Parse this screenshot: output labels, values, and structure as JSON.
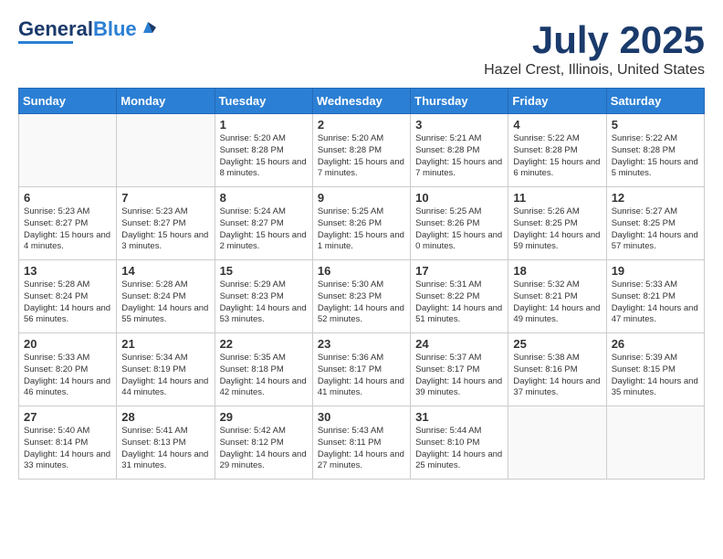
{
  "header": {
    "logo_general": "General",
    "logo_blue": "Blue",
    "month": "July 2025",
    "location": "Hazel Crest, Illinois, United States"
  },
  "weekdays": [
    "Sunday",
    "Monday",
    "Tuesday",
    "Wednesday",
    "Thursday",
    "Friday",
    "Saturday"
  ],
  "weeks": [
    [
      {
        "day": "",
        "info": ""
      },
      {
        "day": "",
        "info": ""
      },
      {
        "day": "1",
        "info": "Sunrise: 5:20 AM\nSunset: 8:28 PM\nDaylight: 15 hours and 8 minutes."
      },
      {
        "day": "2",
        "info": "Sunrise: 5:20 AM\nSunset: 8:28 PM\nDaylight: 15 hours and 7 minutes."
      },
      {
        "day": "3",
        "info": "Sunrise: 5:21 AM\nSunset: 8:28 PM\nDaylight: 15 hours and 7 minutes."
      },
      {
        "day": "4",
        "info": "Sunrise: 5:22 AM\nSunset: 8:28 PM\nDaylight: 15 hours and 6 minutes."
      },
      {
        "day": "5",
        "info": "Sunrise: 5:22 AM\nSunset: 8:28 PM\nDaylight: 15 hours and 5 minutes."
      }
    ],
    [
      {
        "day": "6",
        "info": "Sunrise: 5:23 AM\nSunset: 8:27 PM\nDaylight: 15 hours and 4 minutes."
      },
      {
        "day": "7",
        "info": "Sunrise: 5:23 AM\nSunset: 8:27 PM\nDaylight: 15 hours and 3 minutes."
      },
      {
        "day": "8",
        "info": "Sunrise: 5:24 AM\nSunset: 8:27 PM\nDaylight: 15 hours and 2 minutes."
      },
      {
        "day": "9",
        "info": "Sunrise: 5:25 AM\nSunset: 8:26 PM\nDaylight: 15 hours and 1 minute."
      },
      {
        "day": "10",
        "info": "Sunrise: 5:25 AM\nSunset: 8:26 PM\nDaylight: 15 hours and 0 minutes."
      },
      {
        "day": "11",
        "info": "Sunrise: 5:26 AM\nSunset: 8:25 PM\nDaylight: 14 hours and 59 minutes."
      },
      {
        "day": "12",
        "info": "Sunrise: 5:27 AM\nSunset: 8:25 PM\nDaylight: 14 hours and 57 minutes."
      }
    ],
    [
      {
        "day": "13",
        "info": "Sunrise: 5:28 AM\nSunset: 8:24 PM\nDaylight: 14 hours and 56 minutes."
      },
      {
        "day": "14",
        "info": "Sunrise: 5:28 AM\nSunset: 8:24 PM\nDaylight: 14 hours and 55 minutes."
      },
      {
        "day": "15",
        "info": "Sunrise: 5:29 AM\nSunset: 8:23 PM\nDaylight: 14 hours and 53 minutes."
      },
      {
        "day": "16",
        "info": "Sunrise: 5:30 AM\nSunset: 8:23 PM\nDaylight: 14 hours and 52 minutes."
      },
      {
        "day": "17",
        "info": "Sunrise: 5:31 AM\nSunset: 8:22 PM\nDaylight: 14 hours and 51 minutes."
      },
      {
        "day": "18",
        "info": "Sunrise: 5:32 AM\nSunset: 8:21 PM\nDaylight: 14 hours and 49 minutes."
      },
      {
        "day": "19",
        "info": "Sunrise: 5:33 AM\nSunset: 8:21 PM\nDaylight: 14 hours and 47 minutes."
      }
    ],
    [
      {
        "day": "20",
        "info": "Sunrise: 5:33 AM\nSunset: 8:20 PM\nDaylight: 14 hours and 46 minutes."
      },
      {
        "day": "21",
        "info": "Sunrise: 5:34 AM\nSunset: 8:19 PM\nDaylight: 14 hours and 44 minutes."
      },
      {
        "day": "22",
        "info": "Sunrise: 5:35 AM\nSunset: 8:18 PM\nDaylight: 14 hours and 42 minutes."
      },
      {
        "day": "23",
        "info": "Sunrise: 5:36 AM\nSunset: 8:17 PM\nDaylight: 14 hours and 41 minutes."
      },
      {
        "day": "24",
        "info": "Sunrise: 5:37 AM\nSunset: 8:17 PM\nDaylight: 14 hours and 39 minutes."
      },
      {
        "day": "25",
        "info": "Sunrise: 5:38 AM\nSunset: 8:16 PM\nDaylight: 14 hours and 37 minutes."
      },
      {
        "day": "26",
        "info": "Sunrise: 5:39 AM\nSunset: 8:15 PM\nDaylight: 14 hours and 35 minutes."
      }
    ],
    [
      {
        "day": "27",
        "info": "Sunrise: 5:40 AM\nSunset: 8:14 PM\nDaylight: 14 hours and 33 minutes."
      },
      {
        "day": "28",
        "info": "Sunrise: 5:41 AM\nSunset: 8:13 PM\nDaylight: 14 hours and 31 minutes."
      },
      {
        "day": "29",
        "info": "Sunrise: 5:42 AM\nSunset: 8:12 PM\nDaylight: 14 hours and 29 minutes."
      },
      {
        "day": "30",
        "info": "Sunrise: 5:43 AM\nSunset: 8:11 PM\nDaylight: 14 hours and 27 minutes."
      },
      {
        "day": "31",
        "info": "Sunrise: 5:44 AM\nSunset: 8:10 PM\nDaylight: 14 hours and 25 minutes."
      },
      {
        "day": "",
        "info": ""
      },
      {
        "day": "",
        "info": ""
      }
    ]
  ]
}
